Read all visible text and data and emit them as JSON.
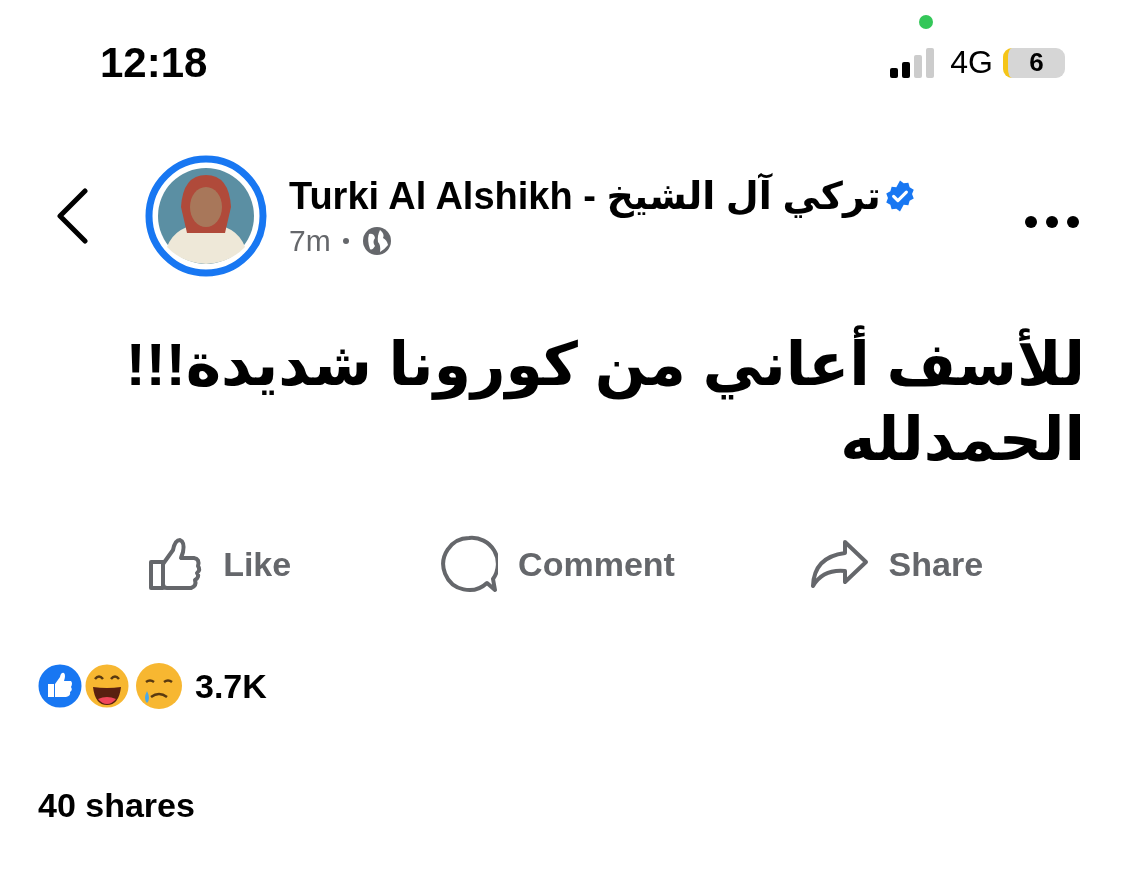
{
  "status_bar": {
    "time": "12:18",
    "network": "4G",
    "battery": "6"
  },
  "post": {
    "author": "Turki Al Alshikh - تركي آل الشيخ",
    "verified": true,
    "time": "7m",
    "text": "للأسف أعاني من كورونا شديدة!!!\nالحمدلله"
  },
  "actions": {
    "like": "Like",
    "comment": "Comment",
    "share": "Share"
  },
  "reactions": {
    "count": "3.7K"
  },
  "shares": "40 shares"
}
